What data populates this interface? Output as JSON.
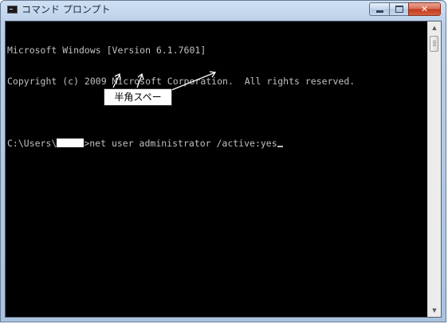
{
  "window": {
    "title": "コマンド プロンプト",
    "app_icon": "console-icon",
    "buttons": {
      "minimize_icon": "minimize-icon",
      "maximize_icon": "maximize-icon",
      "close_icon": "close-icon"
    }
  },
  "console": {
    "lines": [
      "Microsoft Windows [Version 6.1.7601]",
      "Copyright (c) 2009 Microsoft Corporation.  All rights reserved.",
      ""
    ],
    "prompt_prefix": "C:\\Users\\",
    "prompt_suffix": ">",
    "command": "net user administrator /active:yes",
    "text_color": "#c0c0c0",
    "background_color": "#000000"
  },
  "annotation": {
    "label": "半角スペー",
    "arrow_color": "#ffffff"
  },
  "scrollbar": {
    "up_icon": "scroll-up-icon",
    "down_icon": "scroll-down-icon"
  }
}
